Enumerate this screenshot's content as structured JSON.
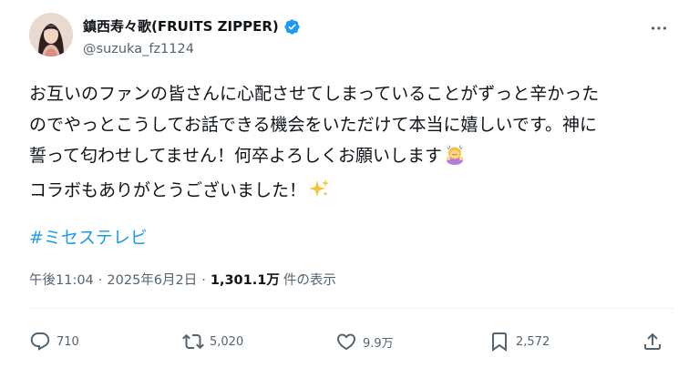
{
  "author": {
    "display_name": "鎮西寿々歌(FRUITS ZIPPER)",
    "handle": "@suzuka_fz1124",
    "verified": true
  },
  "tweet": {
    "lines": [
      "お互いのファンの皆さんに心配させてしまっていることがずっと辛かった",
      "のでやっとこうしてお話できる機会をいただけて本当に嬉しいです。神に",
      "誓って匂わせしてません！何卒よろしくお願いします",
      "コラボもありがとうございました！"
    ],
    "line3_emoji": "bowing-woman-emoji",
    "line4_emoji": "sparkles-emoji",
    "hashtag": "#ミセステレビ"
  },
  "meta": {
    "time": "午後11:04",
    "separator": "·",
    "date": "2025年6月2日",
    "views_count": "1,301.1万",
    "views_label": "件の表示"
  },
  "actions": {
    "replies": "710",
    "reposts": "5,020",
    "likes": "9.9万",
    "bookmarks": "2,572"
  },
  "colors": {
    "text": "#0f1419",
    "secondary": "#536471",
    "link": "#1d9bf0",
    "verified": "#1d9bf0",
    "divider": "#eff3f4"
  }
}
